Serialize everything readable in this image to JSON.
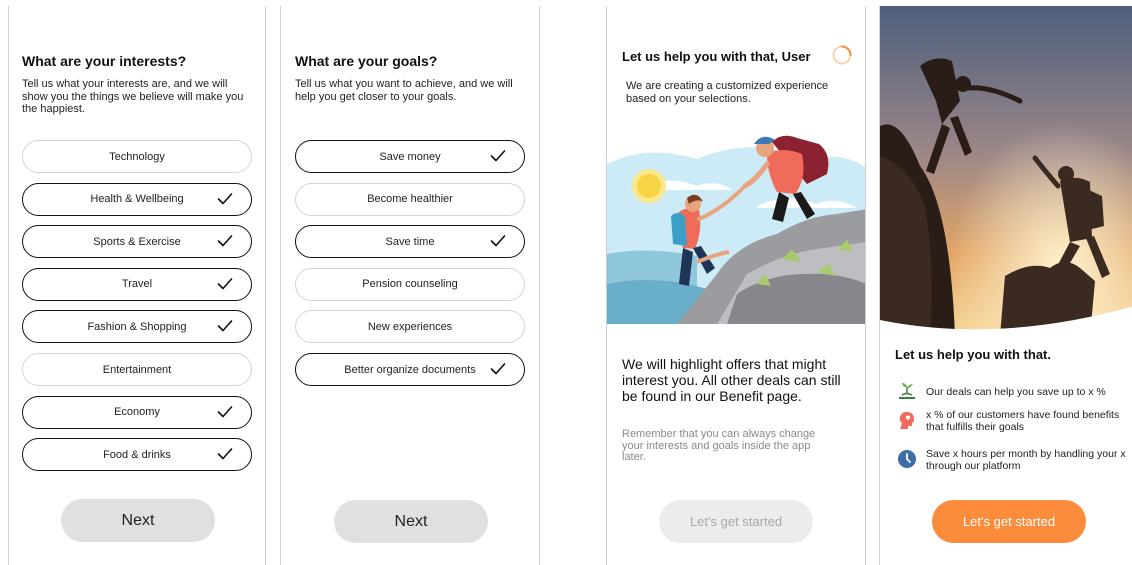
{
  "interests": {
    "title": "What are your interests?",
    "description": "Tell us what your interests are, and we will show you the things we believe will make you the happiest.",
    "options": [
      {
        "label": "Technology",
        "selected": false
      },
      {
        "label": "Health & Wellbeing",
        "selected": true
      },
      {
        "label": "Sports & Exercise",
        "selected": true
      },
      {
        "label": "Travel",
        "selected": true
      },
      {
        "label": "Fashion & Shopping",
        "selected": true
      },
      {
        "label": "Entertainment",
        "selected": false
      },
      {
        "label": "Economy",
        "selected": true
      },
      {
        "label": "Food & drinks",
        "selected": true
      }
    ],
    "next_label": "Next"
  },
  "goals": {
    "title": "What are your goals?",
    "description": "Tell us what you want to achieve, and we will help you get closer to your goals.",
    "options": [
      {
        "label": "Save money",
        "selected": true
      },
      {
        "label": "Become healthier",
        "selected": false
      },
      {
        "label": "Save time",
        "selected": true
      },
      {
        "label": "Pension counseling",
        "selected": false
      },
      {
        "label": "New experiences",
        "selected": false
      },
      {
        "label": "Better organize documents",
        "selected": true
      }
    ],
    "next_label": "Next"
  },
  "loading": {
    "title": "Let us help you with that, User",
    "description": "We are creating a customized experience based on your selections.",
    "illustration_icon": "climbers-helping-illustration",
    "highlight": "We will highlight offers that might interest you. All other deals can still be found in our Benefit page.",
    "note": "Remember that you can always change your interests and goals inside the app later.",
    "cta_label": "Let's get started"
  },
  "summary": {
    "hero_icon": "climbers-silhouette-photo",
    "title": "Let us help you with that.",
    "benefits": [
      {
        "icon": "money-plant-icon",
        "text": "Our deals can help you save up to x %"
      },
      {
        "icon": "heart-head-icon",
        "text": "x % of our customers have found benefits that fulfills their goals"
      },
      {
        "icon": "clock-icon",
        "text": "Save x hours per month by handling your x through our platform"
      }
    ],
    "cta_label": "Let's get started"
  },
  "colors": {
    "accent": "#fb8c3c",
    "selected_border": "#111111",
    "unselected_border": "#d4d4d4",
    "disabled_button": "#ececec",
    "gray_button": "#e0e0e0"
  }
}
